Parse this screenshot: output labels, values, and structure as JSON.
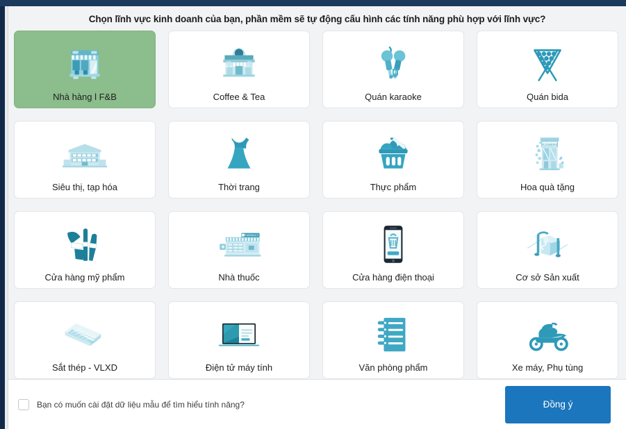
{
  "window": {
    "topbar_color": "#1b3a5c",
    "sidebar_color": "#13294a"
  },
  "modal": {
    "title": "Chọn lĩnh vực kinh doanh của bạn, phần mềm sẽ tự động cấu hình các tính năng phù hợp với lĩnh vực?",
    "selected_index": 0,
    "selected_color": "#8cbd8c",
    "accent_color": "#2b9cbd",
    "cards": [
      {
        "label": "Nhà hàng l F&B",
        "icon": "restaurant-storefront-icon",
        "selected": true
      },
      {
        "label": "Coffee & Tea",
        "icon": "cafe-storefront-icon",
        "selected": false
      },
      {
        "label": "Quán karaoke",
        "icon": "microphones-icon",
        "selected": false
      },
      {
        "label": "Quán bida",
        "icon": "billiards-rack-icon",
        "selected": false
      },
      {
        "label": "Siêu thị, tạp hóa",
        "icon": "supermarket-building-icon",
        "selected": false
      },
      {
        "label": "Thời trang",
        "icon": "dress-icon",
        "selected": false
      },
      {
        "label": "Thực phẩm",
        "icon": "food-basket-icon",
        "selected": false
      },
      {
        "label": "Hoa quà tặng",
        "icon": "flower-shop-icon",
        "selected": false
      },
      {
        "label": "Cửa hàng mỹ phẩm",
        "icon": "makeup-brushes-icon",
        "selected": false
      },
      {
        "label": "Nhà thuốc",
        "icon": "pharmacy-storefront-icon",
        "selected": false
      },
      {
        "label": "Cửa hàng điện thoại",
        "icon": "smartphone-shopping-icon",
        "selected": false
      },
      {
        "label": "Cơ sở Sản xuất",
        "icon": "factory-machine-icon",
        "selected": false
      },
      {
        "label": "Sắt thép - VLXD",
        "icon": "steel-sheets-icon",
        "selected": false
      },
      {
        "label": "Điện tử máy tính",
        "icon": "laptop-icon",
        "selected": false
      },
      {
        "label": "Văn phòng phẩm",
        "icon": "spiral-notebook-icon",
        "selected": false
      },
      {
        "label": "Xe máy, Phụ tùng",
        "icon": "scooter-icon",
        "selected": false
      }
    ]
  },
  "footer": {
    "checkbox_label": "Bạn có muốn cài đặt dữ liệu mẫu để tìm hiểu tính năng?",
    "checkbox_checked": false,
    "agree_label": "Đồng ý",
    "agree_color": "#1b76bd"
  }
}
